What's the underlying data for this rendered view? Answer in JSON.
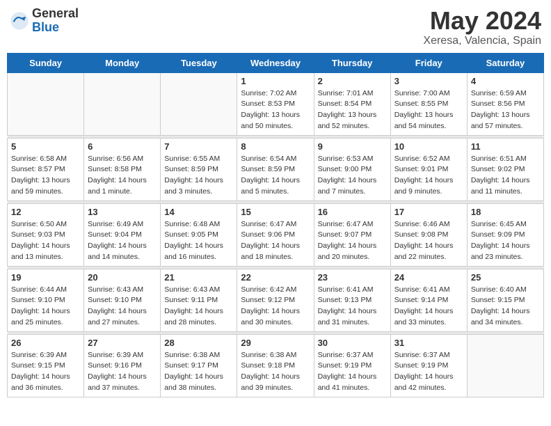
{
  "header": {
    "logo_general": "General",
    "logo_blue": "Blue",
    "month_year": "May 2024",
    "location": "Xeresa, Valencia, Spain"
  },
  "days_of_week": [
    "Sunday",
    "Monday",
    "Tuesday",
    "Wednesday",
    "Thursday",
    "Friday",
    "Saturday"
  ],
  "weeks": [
    [
      {
        "day": "",
        "sunrise": "",
        "sunset": "",
        "daylight": ""
      },
      {
        "day": "",
        "sunrise": "",
        "sunset": "",
        "daylight": ""
      },
      {
        "day": "",
        "sunrise": "",
        "sunset": "",
        "daylight": ""
      },
      {
        "day": "1",
        "sunrise": "Sunrise: 7:02 AM",
        "sunset": "Sunset: 8:53 PM",
        "daylight": "Daylight: 13 hours and 50 minutes."
      },
      {
        "day": "2",
        "sunrise": "Sunrise: 7:01 AM",
        "sunset": "Sunset: 8:54 PM",
        "daylight": "Daylight: 13 hours and 52 minutes."
      },
      {
        "day": "3",
        "sunrise": "Sunrise: 7:00 AM",
        "sunset": "Sunset: 8:55 PM",
        "daylight": "Daylight: 13 hours and 54 minutes."
      },
      {
        "day": "4",
        "sunrise": "Sunrise: 6:59 AM",
        "sunset": "Sunset: 8:56 PM",
        "daylight": "Daylight: 13 hours and 57 minutes."
      }
    ],
    [
      {
        "day": "5",
        "sunrise": "Sunrise: 6:58 AM",
        "sunset": "Sunset: 8:57 PM",
        "daylight": "Daylight: 13 hours and 59 minutes."
      },
      {
        "day": "6",
        "sunrise": "Sunrise: 6:56 AM",
        "sunset": "Sunset: 8:58 PM",
        "daylight": "Daylight: 14 hours and 1 minute."
      },
      {
        "day": "7",
        "sunrise": "Sunrise: 6:55 AM",
        "sunset": "Sunset: 8:59 PM",
        "daylight": "Daylight: 14 hours and 3 minutes."
      },
      {
        "day": "8",
        "sunrise": "Sunrise: 6:54 AM",
        "sunset": "Sunset: 8:59 PM",
        "daylight": "Daylight: 14 hours and 5 minutes."
      },
      {
        "day": "9",
        "sunrise": "Sunrise: 6:53 AM",
        "sunset": "Sunset: 9:00 PM",
        "daylight": "Daylight: 14 hours and 7 minutes."
      },
      {
        "day": "10",
        "sunrise": "Sunrise: 6:52 AM",
        "sunset": "Sunset: 9:01 PM",
        "daylight": "Daylight: 14 hours and 9 minutes."
      },
      {
        "day": "11",
        "sunrise": "Sunrise: 6:51 AM",
        "sunset": "Sunset: 9:02 PM",
        "daylight": "Daylight: 14 hours and 11 minutes."
      }
    ],
    [
      {
        "day": "12",
        "sunrise": "Sunrise: 6:50 AM",
        "sunset": "Sunset: 9:03 PM",
        "daylight": "Daylight: 14 hours and 13 minutes."
      },
      {
        "day": "13",
        "sunrise": "Sunrise: 6:49 AM",
        "sunset": "Sunset: 9:04 PM",
        "daylight": "Daylight: 14 hours and 14 minutes."
      },
      {
        "day": "14",
        "sunrise": "Sunrise: 6:48 AM",
        "sunset": "Sunset: 9:05 PM",
        "daylight": "Daylight: 14 hours and 16 minutes."
      },
      {
        "day": "15",
        "sunrise": "Sunrise: 6:47 AM",
        "sunset": "Sunset: 9:06 PM",
        "daylight": "Daylight: 14 hours and 18 minutes."
      },
      {
        "day": "16",
        "sunrise": "Sunrise: 6:47 AM",
        "sunset": "Sunset: 9:07 PM",
        "daylight": "Daylight: 14 hours and 20 minutes."
      },
      {
        "day": "17",
        "sunrise": "Sunrise: 6:46 AM",
        "sunset": "Sunset: 9:08 PM",
        "daylight": "Daylight: 14 hours and 22 minutes."
      },
      {
        "day": "18",
        "sunrise": "Sunrise: 6:45 AM",
        "sunset": "Sunset: 9:09 PM",
        "daylight": "Daylight: 14 hours and 23 minutes."
      }
    ],
    [
      {
        "day": "19",
        "sunrise": "Sunrise: 6:44 AM",
        "sunset": "Sunset: 9:10 PM",
        "daylight": "Daylight: 14 hours and 25 minutes."
      },
      {
        "day": "20",
        "sunrise": "Sunrise: 6:43 AM",
        "sunset": "Sunset: 9:10 PM",
        "daylight": "Daylight: 14 hours and 27 minutes."
      },
      {
        "day": "21",
        "sunrise": "Sunrise: 6:43 AM",
        "sunset": "Sunset: 9:11 PM",
        "daylight": "Daylight: 14 hours and 28 minutes."
      },
      {
        "day": "22",
        "sunrise": "Sunrise: 6:42 AM",
        "sunset": "Sunset: 9:12 PM",
        "daylight": "Daylight: 14 hours and 30 minutes."
      },
      {
        "day": "23",
        "sunrise": "Sunrise: 6:41 AM",
        "sunset": "Sunset: 9:13 PM",
        "daylight": "Daylight: 14 hours and 31 minutes."
      },
      {
        "day": "24",
        "sunrise": "Sunrise: 6:41 AM",
        "sunset": "Sunset: 9:14 PM",
        "daylight": "Daylight: 14 hours and 33 minutes."
      },
      {
        "day": "25",
        "sunrise": "Sunrise: 6:40 AM",
        "sunset": "Sunset: 9:15 PM",
        "daylight": "Daylight: 14 hours and 34 minutes."
      }
    ],
    [
      {
        "day": "26",
        "sunrise": "Sunrise: 6:39 AM",
        "sunset": "Sunset: 9:15 PM",
        "daylight": "Daylight: 14 hours and 36 minutes."
      },
      {
        "day": "27",
        "sunrise": "Sunrise: 6:39 AM",
        "sunset": "Sunset: 9:16 PM",
        "daylight": "Daylight: 14 hours and 37 minutes."
      },
      {
        "day": "28",
        "sunrise": "Sunrise: 6:38 AM",
        "sunset": "Sunset: 9:17 PM",
        "daylight": "Daylight: 14 hours and 38 minutes."
      },
      {
        "day": "29",
        "sunrise": "Sunrise: 6:38 AM",
        "sunset": "Sunset: 9:18 PM",
        "daylight": "Daylight: 14 hours and 39 minutes."
      },
      {
        "day": "30",
        "sunrise": "Sunrise: 6:37 AM",
        "sunset": "Sunset: 9:19 PM",
        "daylight": "Daylight: 14 hours and 41 minutes."
      },
      {
        "day": "31",
        "sunrise": "Sunrise: 6:37 AM",
        "sunset": "Sunset: 9:19 PM",
        "daylight": "Daylight: 14 hours and 42 minutes."
      },
      {
        "day": "",
        "sunrise": "",
        "sunset": "",
        "daylight": ""
      }
    ]
  ]
}
